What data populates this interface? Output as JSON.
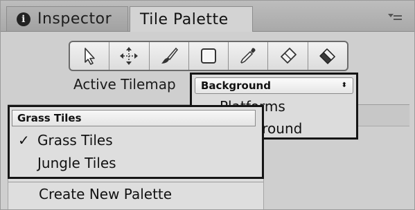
{
  "tabs": [
    {
      "label": "Inspector",
      "icon": "info-icon"
    },
    {
      "label": "Tile Palette"
    }
  ],
  "toolbar": {
    "tools": [
      {
        "name": "select-icon"
      },
      {
        "name": "move-icon"
      },
      {
        "name": "paint-brush-icon"
      },
      {
        "name": "box-fill-icon"
      },
      {
        "name": "eyedropper-icon"
      },
      {
        "name": "eraser-icon"
      },
      {
        "name": "flood-fill-icon"
      }
    ]
  },
  "active_tilemap": {
    "label": "Active Tilemap",
    "selected": "Background",
    "options": [
      {
        "label": "Platforms",
        "checked": false
      },
      {
        "label": "Background",
        "checked": true
      }
    ]
  },
  "palette": {
    "selected": "Grass Tiles",
    "options": [
      {
        "label": "Grass Tiles",
        "checked": true
      },
      {
        "label": "Jungle Tiles",
        "checked": false
      }
    ],
    "create_label": "Create New Palette"
  },
  "check_mark": "✓",
  "updown_glyph": "⬍"
}
